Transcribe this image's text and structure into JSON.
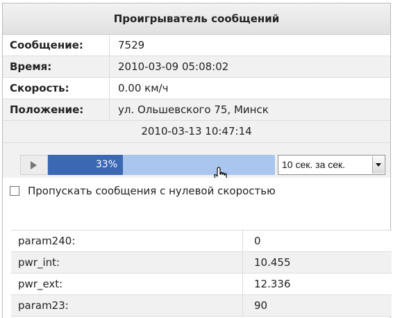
{
  "title": "Проигрыватель сообщений",
  "info": [
    {
      "label": "Сообщение:",
      "value": "7529"
    },
    {
      "label": "Время:",
      "value": "2010-03-09 05:08:02"
    },
    {
      "label": "Скорость:",
      "value": "0.00 км/ч"
    },
    {
      "label": "Положение:",
      "value": "ул. Ольшевского 75, Минск"
    }
  ],
  "current_time": "2010-03-13 10:47:14",
  "player": {
    "play_icon": "play-icon",
    "progress_text": "33%",
    "progress_fraction": 0.33,
    "speed_value": "10 сек. за сек.",
    "cursor_icon": "hand-pointer-icon"
  },
  "skip_zero_speed": {
    "label": "Пропускать сообщения с нулевой скоростью",
    "checked": false
  },
  "params": [
    {
      "name": "param240:",
      "value": "0"
    },
    {
      "name": "pwr_int:",
      "value": "10.455"
    },
    {
      "name": "pwr_ext:",
      "value": "12.336"
    },
    {
      "name": "param23:",
      "value": "90"
    }
  ],
  "colors": {
    "progress_fill": "#3b67b3",
    "progress_track": "#aac6ee"
  }
}
